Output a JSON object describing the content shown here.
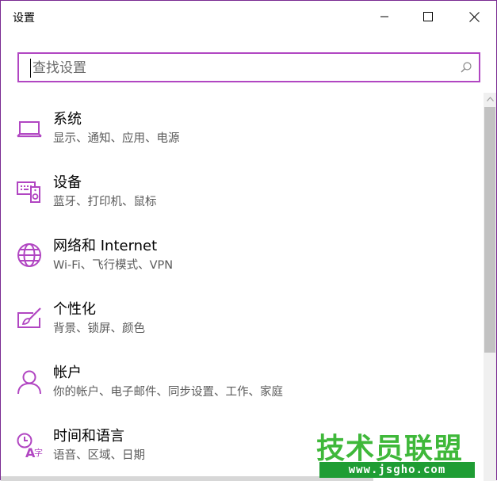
{
  "window": {
    "title": "设置",
    "controls": {
      "minimize": "minimize-icon",
      "maximize": "maximize-icon",
      "close": "close-icon"
    }
  },
  "search": {
    "placeholder": "查找设置",
    "value": "",
    "icon": "search-icon"
  },
  "accent_color": "#b146c2",
  "categories": [
    {
      "title": "系统",
      "desc": "显示、通知、应用、电源",
      "icon": "laptop-icon"
    },
    {
      "title": "设备",
      "desc": "蓝牙、打印机、鼠标",
      "icon": "devices-icon"
    },
    {
      "title": "网络和 Internet",
      "desc": "Wi-Fi、飞行模式、VPN",
      "icon": "globe-icon"
    },
    {
      "title": "个性化",
      "desc": "背景、锁屏、颜色",
      "icon": "personalization-icon"
    },
    {
      "title": "帐户",
      "desc": "你的帐户、电子邮件、同步设置、工作、家庭",
      "icon": "person-icon"
    },
    {
      "title": "时间和语言",
      "desc": "语音、区域、日期",
      "icon": "time-language-icon"
    }
  ],
  "watermark": {
    "name": "技术员联盟",
    "url": "www.jsgho.com"
  }
}
